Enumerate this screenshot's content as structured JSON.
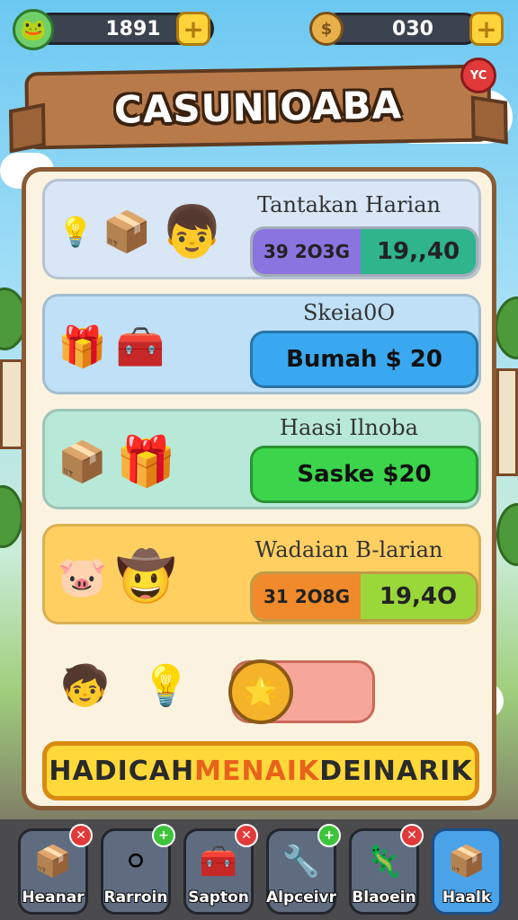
{
  "topbar": {
    "gems": "1891",
    "coins": "030",
    "plus_label": "+",
    "avatar_icon": "frog-avatar-icon",
    "coin_icon": "coin-icon"
  },
  "banner": {
    "title": "CASUNIOABA",
    "pin_label": "YC"
  },
  "cards": [
    {
      "title": "Tantakan Harian",
      "color": "#d8e6f6",
      "icons": [
        "💡",
        "📦",
        "👦"
      ],
      "pill_left": "39 2O3G",
      "pill_right": "19,,40",
      "pill_left_color": "#8a74e0",
      "pill_right_color": "#2fb48c"
    },
    {
      "title": "Skeia0O",
      "color": "#bfe0f6",
      "icons": [
        "🎁",
        "🧰"
      ],
      "button": "Bumah $ 20",
      "button_color": "#3aa8f0"
    },
    {
      "title": "Haasi Ilnoba",
      "color": "#b8e8d8",
      "icons": [
        "📦",
        "🎁"
      ],
      "button": "Saske $20",
      "button_color": "#3cd44a"
    },
    {
      "title": "Wadaian B-larian",
      "color": "#ffcf62",
      "icons": [
        "🐷",
        "🤠"
      ],
      "pill_left": "31 2O8G",
      "pill_right": "19,4O",
      "pill_left_color": "#f08a2a",
      "pill_right_color": "#9ad83a"
    }
  ],
  "extra": {
    "icons": [
      "🧒",
      "💡"
    ],
    "knob_icon": "🌟"
  },
  "cta": {
    "part1": "HADICAH ",
    "part2": "MENAIK",
    "part3": " DEINARIK"
  },
  "nav": [
    {
      "label": "Heanar",
      "icon": "📦",
      "badge": "✕",
      "badge_color": "#e23a3a"
    },
    {
      "label": "Rarroin",
      "icon": "⚪",
      "badge": "+",
      "badge_color": "#3cc43a"
    },
    {
      "label": "Sapton",
      "icon": "🧰",
      "badge": "✕",
      "badge_color": "#e23a3a"
    },
    {
      "label": "Alpceivr",
      "icon": "🔧",
      "badge": "+",
      "badge_color": "#3cc43a"
    },
    {
      "label": "Blaoein",
      "icon": "🦎",
      "badge": "✕",
      "badge_color": "#e23a3a"
    },
    {
      "label": "Haalk",
      "icon": "📦",
      "badge": "",
      "badge_color": ""
    }
  ]
}
